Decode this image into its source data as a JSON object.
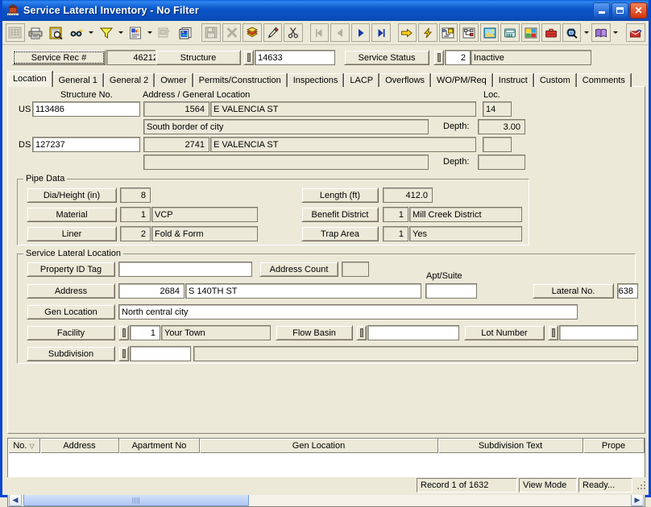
{
  "window": {
    "title": "Service Lateral Inventory - No Filter",
    "icon": "building-icon",
    "buttons": {
      "minimize": "minimize-icon",
      "maximize": "maximize-icon",
      "close": "close-icon"
    }
  },
  "toolbar": {
    "items": [
      {
        "name": "grid-view-icon",
        "label": "Grid View",
        "disabled": true
      },
      {
        "name": "print-icon",
        "label": "Print"
      },
      {
        "name": "print-preview-icon",
        "label": "Print Preview"
      },
      {
        "name": "find-icon",
        "label": "Find",
        "dropdown": true
      },
      {
        "name": "filter-icon",
        "label": "Filter",
        "dropdown": true
      },
      {
        "name": "report-icon",
        "label": "Report",
        "dropdown": true
      },
      {
        "name": "copy-record-icon",
        "label": "Copy Record",
        "disabled": true
      },
      {
        "name": "duplicate-icon",
        "label": "Duplicate"
      },
      {
        "name": "save-icon",
        "label": "Save",
        "disabled": true
      },
      {
        "name": "delete-icon",
        "label": "Delete",
        "disabled": true
      },
      {
        "name": "undo-icon",
        "label": "Undo"
      },
      {
        "name": "edit-icon",
        "label": "Edit"
      },
      {
        "name": "cut-icon",
        "label": "Cut"
      },
      {
        "name": "first-record-icon",
        "label": "First Record",
        "disabled": true
      },
      {
        "name": "previous-record-icon",
        "label": "Previous Record",
        "disabled": true
      },
      {
        "name": "next-record-icon",
        "label": "Next Record"
      },
      {
        "name": "last-record-icon",
        "label": "Last Record"
      },
      {
        "name": "goto-icon",
        "label": "Go To"
      },
      {
        "name": "lightning-icon",
        "label": "Quick Action"
      },
      {
        "name": "schematic-icon",
        "label": "Schematic"
      },
      {
        "name": "hierarchy-icon",
        "label": "Hierarchy"
      },
      {
        "name": "image-icon",
        "label": "Images"
      },
      {
        "name": "phone-icon",
        "label": "Contacts"
      },
      {
        "name": "map-icon",
        "label": "Map"
      },
      {
        "name": "toolbox-icon",
        "label": "Tools"
      },
      {
        "name": "globe-search-icon",
        "label": "Web Lookup",
        "dropdown": true
      },
      {
        "name": "help-book-icon",
        "label": "Help",
        "dropdown": true
      },
      {
        "name": "exit-icon",
        "label": "Exit"
      }
    ]
  },
  "header": {
    "service_rec_button": "Service Rec #",
    "service_rec_value": "46212",
    "structure_button": "Structure",
    "structure_value": "14633",
    "service_status_button": "Service Status",
    "service_status_code": "2",
    "service_status_text": "Inactive"
  },
  "tabs": [
    {
      "label": "Location",
      "active": true
    },
    {
      "label": "General 1",
      "active": false
    },
    {
      "label": "General 2",
      "active": false
    },
    {
      "label": "Owner",
      "active": false
    },
    {
      "label": "Permits/Construction",
      "active": false
    },
    {
      "label": "Inspections",
      "active": false
    },
    {
      "label": "LACP",
      "active": false
    },
    {
      "label": "Overflows",
      "active": false
    },
    {
      "label": "WO/PM/Req",
      "active": false
    },
    {
      "label": "Instruct",
      "active": false
    },
    {
      "label": "Custom",
      "active": false
    },
    {
      "label": "Comments",
      "active": false
    }
  ],
  "location": {
    "col_structure_no": "Structure No.",
    "col_address": "Address / General Location",
    "col_loc": "Loc.",
    "us_label": "US",
    "us_structure": "113486",
    "us_house_no": "1564",
    "us_street": "E VALENCIA ST",
    "us_loc": "14",
    "us_note": "South border of city",
    "us_depth_label": "Depth:",
    "us_depth": "3.00",
    "ds_label": "DS",
    "ds_structure": "127237",
    "ds_house_no": "2741",
    "ds_street": "E VALENCIA ST",
    "ds_loc": "",
    "ds_note": "",
    "ds_depth_label": "Depth:",
    "ds_depth": ""
  },
  "pipe_data": {
    "legend": "Pipe Data",
    "dia_label": "Dia/Height (in)",
    "dia_value": "8",
    "material_label": "Material",
    "material_code": "1",
    "material_text": "VCP",
    "liner_label": "Liner",
    "liner_code": "2",
    "liner_text": "Fold & Form",
    "length_label": "Length (ft)",
    "length_value": "412.0",
    "benefit_label": "Benefit District",
    "benefit_code": "1",
    "benefit_text": "Mill Creek District",
    "trap_label": "Trap Area",
    "trap_code": "1",
    "trap_text": "Yes"
  },
  "service_lateral_location": {
    "legend": "Service Lateral Location",
    "property_id_label": "Property ID Tag",
    "property_id_value": "",
    "address_count_label": "Address Count",
    "address_count_value": "",
    "apt_suite_label": "Apt/Suite",
    "apt_suite_value": "",
    "address_label": "Address",
    "address_no": "2684",
    "address_street": "S 140TH ST",
    "lateral_no_label": "Lateral No.",
    "lateral_no_value": "638",
    "gen_location_label": "Gen Location",
    "gen_location_value": "North central city",
    "facility_label": "Facility",
    "facility_code": "1",
    "facility_text": "Your Town",
    "flow_basin_label": "Flow Basin",
    "flow_basin_value": "",
    "lot_number_label": "Lot Number",
    "lot_number_value": "",
    "subdivision_label": "Subdivision",
    "subdivision_code": "",
    "subdivision_text": ""
  },
  "grid": {
    "columns": [
      {
        "label": "No.",
        "sort": "descending"
      },
      {
        "label": "Address"
      },
      {
        "label": "Apartment No"
      },
      {
        "label": "Gen Location"
      },
      {
        "label": "Subdivision Text"
      },
      {
        "label": "Prope"
      }
    ],
    "rows": [],
    "scroll_left_icon": "scroll-left-arrow"
  },
  "statusbar": {
    "record": "Record 1 of 1632",
    "mode": "View Mode",
    "state": "Ready..."
  }
}
